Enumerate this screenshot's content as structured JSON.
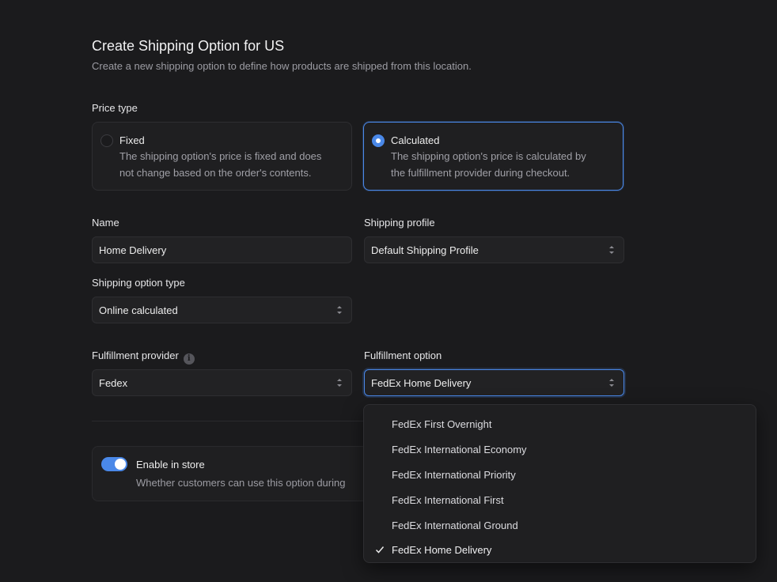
{
  "header": {
    "title": "Create Shipping Option for US",
    "subtitle": "Create a new shipping option to define how products are shipped from this location."
  },
  "price_type": {
    "label": "Price type",
    "options": [
      {
        "title": "Fixed",
        "desc_line1": "The shipping option's price is fixed and does",
        "desc_line2": "not change based on the order's contents.",
        "selected": false
      },
      {
        "title": "Calculated",
        "desc_line1": "The shipping option's price is calculated by",
        "desc_line2": "the fulfillment provider during checkout.",
        "selected": true
      }
    ]
  },
  "name": {
    "label": "Name",
    "value": "Home Delivery"
  },
  "shipping_profile": {
    "label": "Shipping profile",
    "value": "Default Shipping Profile"
  },
  "shipping_option_type": {
    "label": "Shipping option type",
    "value": "Online calculated"
  },
  "fulfillment_provider": {
    "label": "Fulfillment provider",
    "value": "Fedex",
    "info_icon": "i"
  },
  "fulfillment_option": {
    "label": "Fulfillment option",
    "value": "FedEx Home Delivery",
    "options": [
      "FedEx First Overnight",
      "FedEx International Economy",
      "FedEx International Priority",
      "FedEx International First",
      "FedEx International Ground",
      "FedEx Home Delivery"
    ],
    "selected_index": 5
  },
  "enable_in_store": {
    "title": "Enable in store",
    "desc": "Whether customers can use this option during",
    "enabled": true
  },
  "colors": {
    "accent": "#4a88e8",
    "background": "#1b1b1d"
  }
}
